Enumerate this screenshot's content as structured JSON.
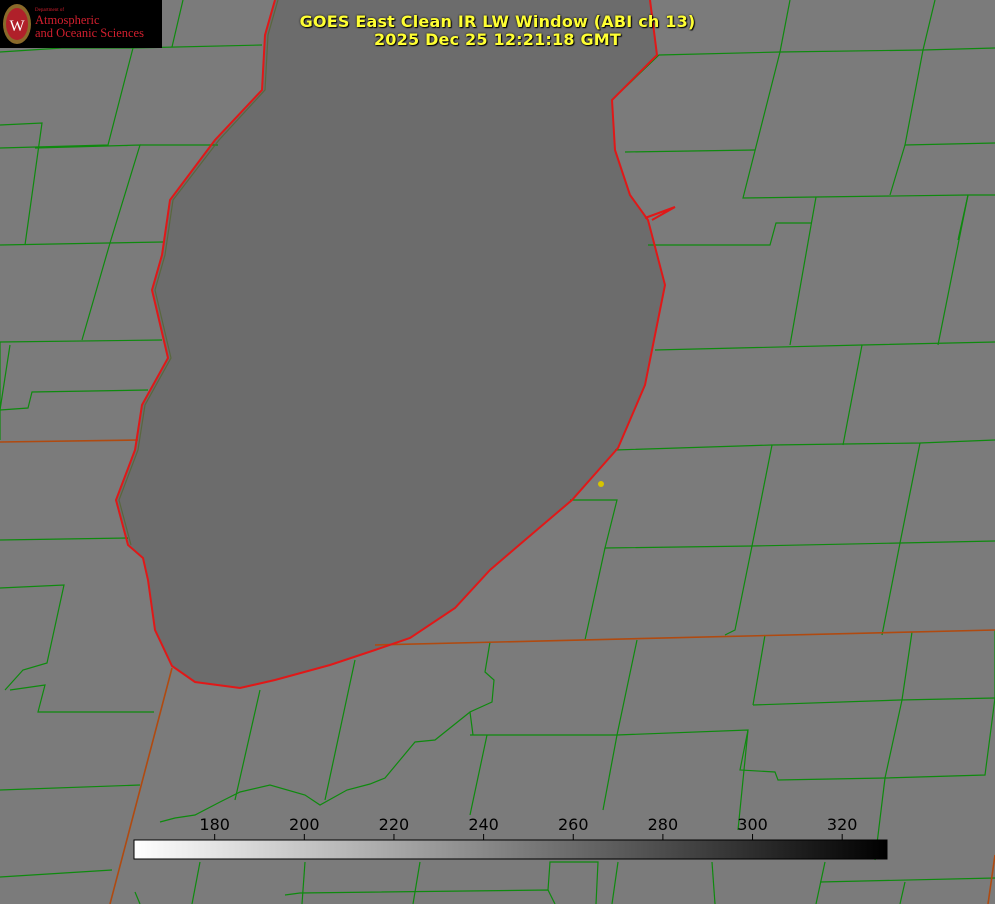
{
  "header": {
    "title_line1": "GOES East Clean IR LW Window (ABI ch 13)",
    "title_line2": "2025 Dec 25 12:21:18 GMT"
  },
  "logo": {
    "dept": "Department of",
    "line1": "Atmospheric",
    "line2": "and Oceanic Sciences",
    "seal_letter": "W"
  },
  "colorbar": {
    "ticks": [
      "180",
      "200",
      "220",
      "240",
      "260",
      "280",
      "300",
      "320"
    ],
    "range": [
      162,
      330
    ],
    "gradient": "white-to-black"
  },
  "colors": {
    "lake_fill": "#6c6c6c",
    "land_fill": "#7a7a7a",
    "county_lines": "#0e8a0e",
    "lake_shoreline": "#e01818",
    "state_border": "#b04a10",
    "title_text": "#ffff33",
    "site_marker": "#d6c400"
  }
}
